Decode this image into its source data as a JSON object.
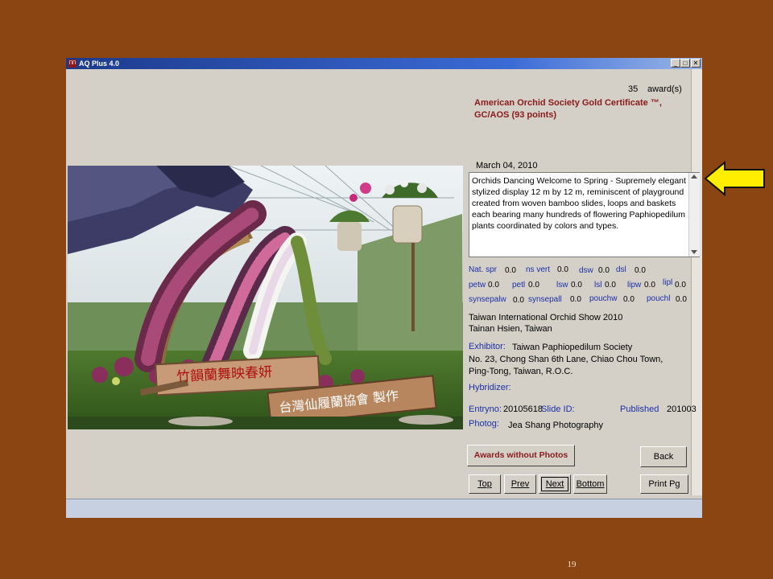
{
  "window": {
    "title": "AQ Plus 4.0",
    "icon_text": "ПП",
    "controls": {
      "minimize": "_",
      "maximize": "□",
      "close": "✕"
    }
  },
  "award": {
    "count": "35",
    "count_label": "award(s)",
    "name_line1": "American Orchid Society Gold Certificate ™,",
    "name_line2": "GC/AOS (93 points)"
  },
  "date": "March 04, 2010",
  "description": "Orchids Dancing Welcome to Spring - Supremely elegant stylized display 12 m by 12 m, reminiscent of playground created from woven bamboo slides, loops and baskets each bearing many hundreds of flowering Paphiopedilum plants coordinated by colors and types.",
  "measurements": {
    "row1": [
      {
        "label": "Nat. spr",
        "value": "0.0"
      },
      {
        "label": "ns vert",
        "value": "0.0"
      },
      {
        "label": "dsw",
        "value": "0.0"
      },
      {
        "label": "dsl",
        "value": "0.0"
      }
    ],
    "row2": [
      {
        "label": "petw",
        "value": "0.0"
      },
      {
        "label": "petl",
        "value": "0.0"
      },
      {
        "label": "lsw",
        "value": "0.0"
      },
      {
        "label": "lsl",
        "value": "0.0"
      },
      {
        "label": "lipw",
        "value": "0.0"
      },
      {
        "label": "lipl",
        "value": "0.0"
      }
    ],
    "row3": [
      {
        "label": "synsepalw",
        "value": "0.0"
      },
      {
        "label": "synsepall",
        "value": "0.0"
      },
      {
        "label": "pouchw",
        "value": "0.0"
      },
      {
        "label": "pouchl",
        "value": "0.0"
      }
    ]
  },
  "show": {
    "name": "Taiwan International Orchid Show 2010",
    "location": "Tainan Hsien, Taiwan"
  },
  "exhibitor": {
    "label": "Exhibitor:",
    "name": "Taiwan Paphiopedilum Society",
    "address1": "No. 23, Chong Shan 6th Lane, Chiao Chou Town,",
    "address2": "Ping-Tong, Taiwan, R.O.C."
  },
  "hybridizer": {
    "label": "Hybridizer:",
    "value": ""
  },
  "entry": {
    "label": "Entryno:",
    "value": "20105618",
    "slide_label": "Slide ID:",
    "slide_value": "",
    "published_label": "Published",
    "published_value": "201003"
  },
  "photog": {
    "label": "Photog:",
    "value": "Jea Shang Photography"
  },
  "buttons": {
    "awards_without_photos": "Awards without Photos",
    "back": "Back",
    "top": "Top",
    "prev": "Prev",
    "next": "Next",
    "bottom": "Bottom",
    "print": "Print Pg"
  },
  "photo": {
    "sign1": "竹韻蘭舞映春妍",
    "sign2": "台灣仙履蘭協會 製作"
  },
  "slide_number": "19",
  "colors": {
    "background": "#8b4513",
    "arrow": "#ffee00",
    "label_blue": "#1a2fa8",
    "award_red": "#8b1a1a"
  }
}
